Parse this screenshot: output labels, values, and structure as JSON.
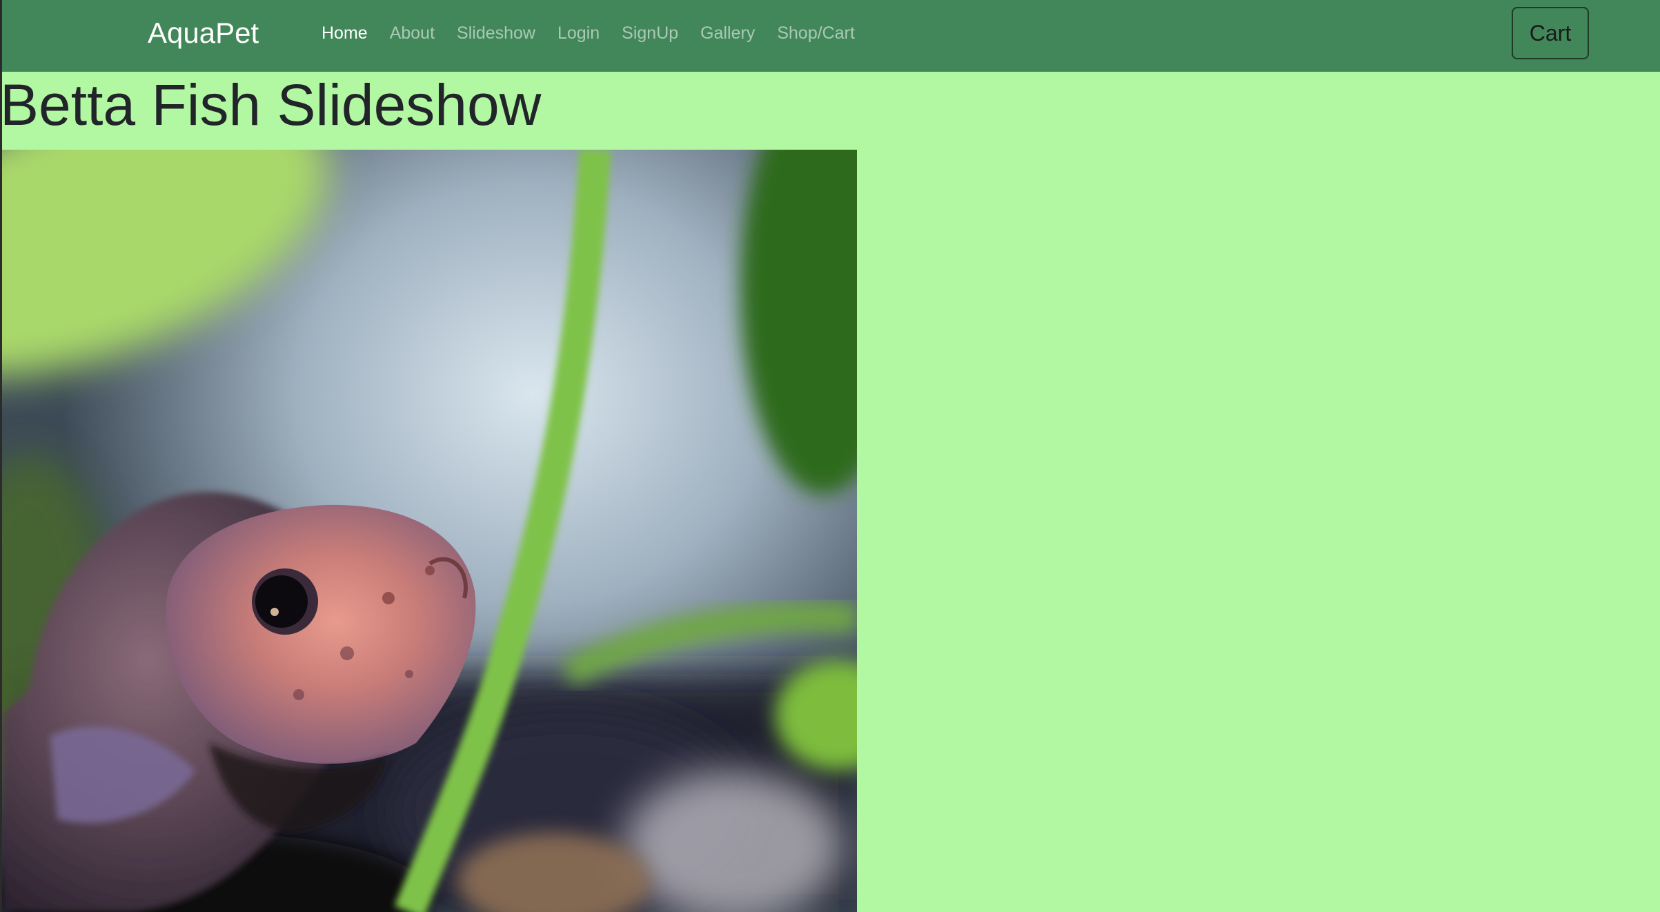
{
  "navbar": {
    "brand": "AquaPet",
    "links": [
      {
        "label": "Home",
        "active": true
      },
      {
        "label": "About",
        "active": false
      },
      {
        "label": "Slideshow",
        "active": false
      },
      {
        "label": "Login",
        "active": false
      },
      {
        "label": "SignUp",
        "active": false
      },
      {
        "label": "Gallery",
        "active": false
      },
      {
        "label": "Shop/Cart",
        "active": false
      }
    ],
    "cart_label": "Cart"
  },
  "main": {
    "title": "Betta Fish Slideshow"
  },
  "colors": {
    "navbar_bg": "#428759",
    "page_bg": "#b2f7a2",
    "nav_active": "#ffffff",
    "nav_inactive": "rgba(255,255,255,0.55)"
  }
}
